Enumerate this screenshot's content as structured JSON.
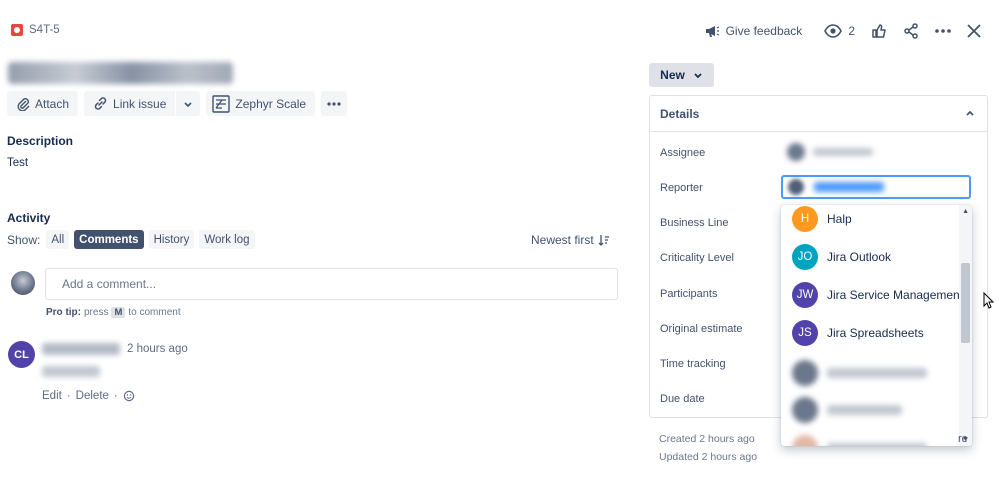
{
  "header": {
    "issue_key": "S4T-5",
    "feedback_label": "Give feedback",
    "watch_count": "2",
    "issue_type_color": "#e5493a"
  },
  "toolbar": {
    "attach": "Attach",
    "link_issue": "Link issue",
    "zephyr": "Zephyr Scale"
  },
  "description": {
    "label": "Description",
    "text": "Test"
  },
  "activity": {
    "label": "Activity",
    "show_label": "Show:",
    "filters": [
      "All",
      "Comments",
      "History",
      "Work log"
    ],
    "active_filter": "Comments",
    "sort_label": "Newest first",
    "comment_placeholder": "Add a comment...",
    "protip_bold": "Pro tip:",
    "protip_press": "press",
    "protip_key": "M",
    "protip_rest": "to comment"
  },
  "comment": {
    "avatar_initials": "CL",
    "avatar_color": "#5243aa",
    "time": "2 hours ago",
    "edit": "Edit",
    "delete": "Delete"
  },
  "status": {
    "label": "New"
  },
  "details": {
    "title": "Details",
    "fields": [
      "Assignee",
      "Reporter",
      "Business Line",
      "Criticality Level",
      "Participants",
      "Original estimate",
      "Time tracking",
      "Due date"
    ]
  },
  "dropdown": {
    "options": [
      {
        "initials": "H",
        "name": "Halp",
        "color": "#ff991f"
      },
      {
        "initials": "JO",
        "name": "Jira Outlook",
        "color": "#00a3bf"
      },
      {
        "initials": "JW",
        "name": "Jira Service Management W",
        "color": "#5243aa"
      },
      {
        "initials": "JS",
        "name": "Jira Spreadsheets",
        "color": "#5243aa"
      }
    ]
  },
  "meta": {
    "created": "Created 2 hours ago",
    "updated": "Updated 2 hours ago",
    "configure_partial": "re"
  }
}
